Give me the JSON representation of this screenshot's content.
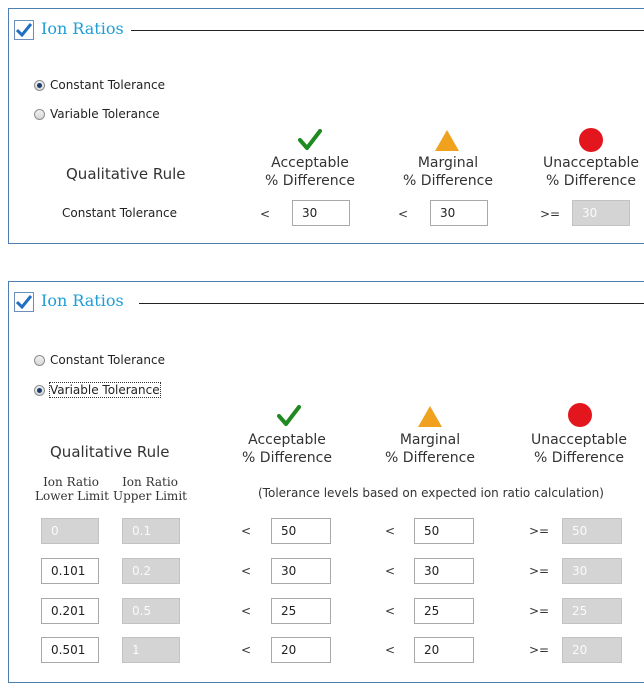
{
  "panel1": {
    "title": "Ion Ratios",
    "checked": true,
    "options": [
      "Constant Tolerance",
      "Variable Tolerance"
    ],
    "selected": "Constant Tolerance",
    "rule_header": "Qualitative Rule",
    "columns": [
      {
        "label": "Acceptable",
        "sublabel": "% Difference",
        "icon": "checkmark-icon",
        "color": "#1f8a1f"
      },
      {
        "label": "Marginal",
        "sublabel": "% Difference",
        "icon": "warning-triangle-icon",
        "color": "#f0a11e"
      },
      {
        "label": "Unacceptable",
        "sublabel": "% Difference",
        "icon": "red-circle-icon",
        "color": "#e3161d"
      }
    ],
    "row": {
      "label": "Constant Tolerance",
      "op1": "<",
      "acceptable": "30",
      "op2": "<",
      "marginal": "30",
      "op3": ">=",
      "unacceptable": "30"
    }
  },
  "panel2": {
    "title": "Ion Ratios",
    "checked": true,
    "options": [
      "Constant Tolerance",
      "Variable Tolerance"
    ],
    "selected": "Variable Tolerance",
    "rule_header": "Qualitative Rule",
    "lower_header": [
      "Ion Ratio",
      "Lower Limit"
    ],
    "upper_header": [
      "Ion Ratio",
      "Upper Limit"
    ],
    "note": "(Tolerance levels based on expected ion ratio calculation)",
    "columns": [
      {
        "label": "Acceptable",
        "sublabel": "% Difference"
      },
      {
        "label": "Marginal",
        "sublabel": "% Difference"
      },
      {
        "label": "Unacceptable",
        "sublabel": "% Difference"
      }
    ],
    "rows": [
      {
        "lower": "0",
        "upper": "0.1",
        "op1": "<",
        "acceptable": "50",
        "op2": "<",
        "marginal": "50",
        "op3": ">=",
        "unacceptable": "50"
      },
      {
        "lower": "0.101",
        "upper": "0.2",
        "op1": "<",
        "acceptable": "30",
        "op2": "<",
        "marginal": "30",
        "op3": ">=",
        "unacceptable": "30"
      },
      {
        "lower": "0.201",
        "upper": "0.5",
        "op1": "<",
        "acceptable": "25",
        "op2": "<",
        "marginal": "25",
        "op3": ">=",
        "unacceptable": "25"
      },
      {
        "lower": "0.501",
        "upper": "1",
        "op1": "<",
        "acceptable": "20",
        "op2": "<",
        "marginal": "20",
        "op3": ">=",
        "unacceptable": "20"
      }
    ]
  }
}
